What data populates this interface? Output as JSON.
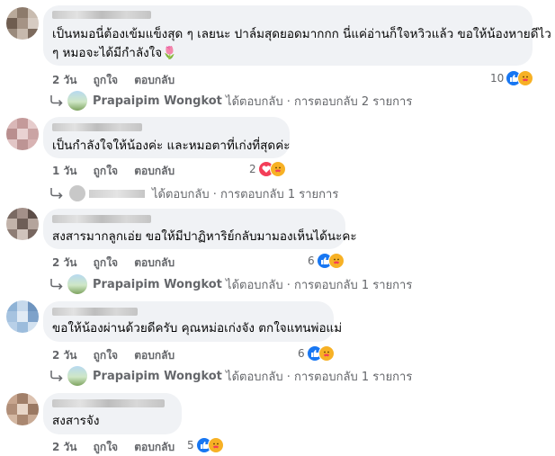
{
  "comments": [
    {
      "text_line1": "เป็นหมอนี่ต้องเข้มแข็งสุด ๆ เลยนะ ปาล์มสุดยอดมากกก นี่แค่อ่านก็ใจหวิวแล้ว ขอให้น้องหายดีไว",
      "text_line2": "ๆ หมอจะได้มีกำลังใจ🌷",
      "time": "2 วัน",
      "like_label": "ถูกใจ",
      "reply_label": "ตอบกลับ",
      "reaction_count": "10",
      "reactions": [
        "like-icon",
        "care-icon"
      ],
      "reply_summary": {
        "name": "Prapaipim Wongkot",
        "text": "ได้ตอบกลับ · การตอบกลับ 2 รายการ"
      }
    },
    {
      "text_line1": "เป็นกำลังใจให้น้องค่ะ และหมอตาที่เก่งที่สุดค่ะ",
      "time": "1 วัน",
      "like_label": "ถูกใจ",
      "reply_label": "ตอบกลับ",
      "reaction_count": "2",
      "reactions": [
        "love-icon",
        "care-icon"
      ],
      "reply_summary": {
        "name": "",
        "text": "ได้ตอบกลับ · การตอบกลับ 1 รายการ"
      }
    },
    {
      "text_line1": "สงสารมากลูกเอ่ย ขอให้มีปาฏิหาริย์กลับมามองเห็นได้นะคะ",
      "time": "2 วัน",
      "like_label": "ถูกใจ",
      "reply_label": "ตอบกลับ",
      "reaction_count": "6",
      "reactions": [
        "like-icon",
        "care-icon"
      ],
      "reply_summary": {
        "name": "Prapaipim Wongkot",
        "text": "ได้ตอบกลับ · การตอบกลับ 1 รายการ"
      }
    },
    {
      "text_line1": "ขอให้น้องผ่านด้วยดีครับ คุณหม่อเก่งจัง ตกใจแทนพ่อแม่",
      "time": "2 วัน",
      "like_label": "ถูกใจ",
      "reply_label": "ตอบกลับ",
      "reaction_count": "6",
      "reactions": [
        "like-icon",
        "care-icon"
      ],
      "reply_summary": {
        "name": "Prapaipim Wongkot",
        "text": "ได้ตอบกลับ · การตอบกลับ 1 รายการ"
      }
    },
    {
      "text_line1": "สงสารจัง",
      "time": "2 วัน",
      "like_label": "ถูกใจ",
      "reply_label": "ตอบกลับ",
      "reaction_count": "5",
      "reactions": [
        "like-icon",
        "care-icon"
      ]
    }
  ],
  "colors": {
    "bubble": "#f0f2f5",
    "like": "#1877f2",
    "love": "#f33e58",
    "care": "#f7b125",
    "meta": "#65676b"
  }
}
